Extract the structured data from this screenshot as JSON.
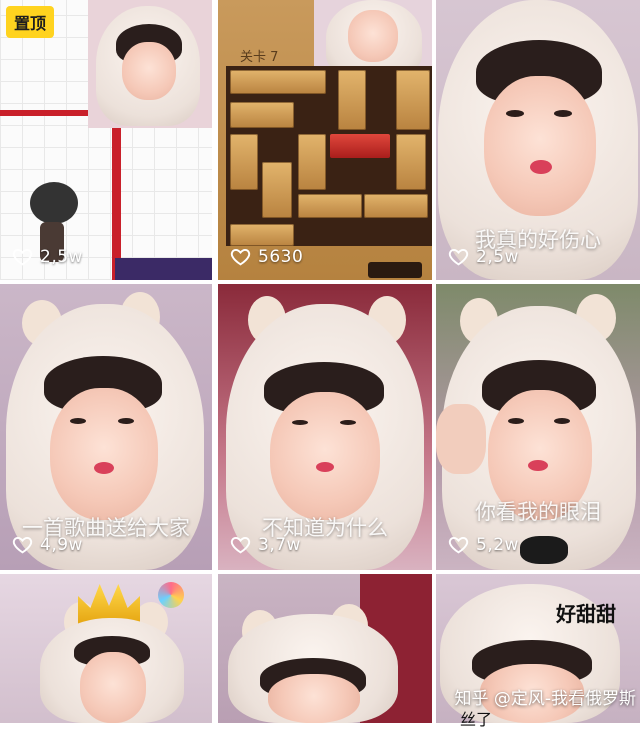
{
  "pin_label": "置顶",
  "game_level": "关卡 7",
  "tiles": [
    {
      "likes": "2,5w",
      "caption": ""
    },
    {
      "likes": "5630",
      "caption": ""
    },
    {
      "likes": "2,5w",
      "caption": "我真的好伤心"
    },
    {
      "likes": "4,9w",
      "caption": "一首歌曲送给大家"
    },
    {
      "likes": "3,7w",
      "caption": "不知道为什么"
    },
    {
      "likes": "5,2w",
      "caption": "你看我的眼泪"
    },
    {
      "likes": "",
      "caption": ""
    },
    {
      "likes": "",
      "caption": ""
    },
    {
      "likes": "",
      "caption": "好甜甜"
    }
  ],
  "watermark": "知乎 @定风-我看俄罗斯",
  "watermark_sub": "丝了",
  "icons": {
    "like": "heart-outline-icon"
  }
}
